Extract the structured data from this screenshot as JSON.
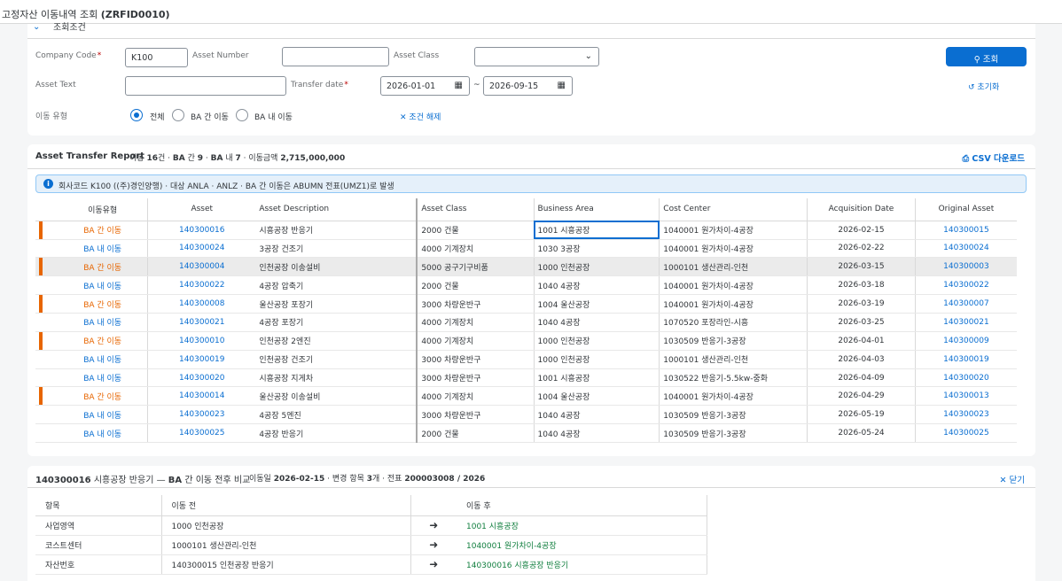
{
  "app": {
    "title": "고정자산 이동내역 조회",
    "code": "(ZRFID0010)"
  },
  "filters": {
    "section_title": "조회조건",
    "company_code_label": "Company Code",
    "company_code_value": "K100",
    "asset_number_label": "Asset Number",
    "asset_number_value": "",
    "asset_class_label": "Asset Class",
    "asset_class_value": "",
    "asset_text_label": "Asset Text",
    "asset_text_value": "",
    "transfer_date_label": "Transfer date",
    "date_from": "2026-01-01",
    "date_sep": "~",
    "date_to": "2026-09-15",
    "move_type_label": "이동 유형",
    "radio_all": "전체",
    "radio_inter": "BA 간 이동",
    "radio_intra": "BA 내 이동",
    "clear_label": "조건 해제",
    "search_label": "조회",
    "reset_label": "초기화"
  },
  "report": {
    "title": "Asset Transfer Report",
    "s_count_pre": "이동",
    "s_count": "16",
    "s_count_unit": "건 ·",
    "s_inter_pre": "BA",
    "s_inter_mid": "간",
    "s_inter": "9",
    "s_dot1": "·",
    "s_intra_pre": "BA",
    "s_intra_mid": "내",
    "s_intra": "7",
    "s_amount_pre": "· 이동금액",
    "s_amount": "2,715,000,000",
    "csv_label": "CSV 다운로드",
    "info": "회사코드 K100 ((주)경인양행) · 대상 ANLA · ANLZ · BA 간 이동은 ABUMN 전표(UMZ1)로 발생",
    "columns": [
      "이동유형",
      "Asset",
      "Asset Description",
      "Asset Class",
      "Business Area",
      "Cost Center",
      "Acquisition Date",
      "Original Asset"
    ],
    "rows": [
      {
        "type": "BA 간 이동",
        "kind": "inter",
        "asset": "140300016",
        "desc": "시흥공장 반응기",
        "cls": "2000 건물",
        "ba": "1001 시흥공장",
        "cc": "1040001 원가차이-4공장",
        "acq": "2026-02-15",
        "orig": "140300015"
      },
      {
        "type": "BA 내 이동",
        "kind": "intra",
        "asset": "140300024",
        "desc": "3공장 건조기",
        "cls": "4000 기계장치",
        "ba": "1030 3공장",
        "cc": "1040001 원가차이-4공장",
        "acq": "2026-02-22",
        "orig": "140300024"
      },
      {
        "type": "BA 간 이동",
        "kind": "inter",
        "asset": "140300004",
        "desc": "인천공장 이송설비",
        "cls": "5000 공구기구비품",
        "ba": "1000 인천공장",
        "cc": "1000101 생산관리-인천",
        "acq": "2026-03-15",
        "orig": "140300003"
      },
      {
        "type": "BA 내 이동",
        "kind": "intra",
        "asset": "140300022",
        "desc": "4공장 압축기",
        "cls": "2000 건물",
        "ba": "1040 4공장",
        "cc": "1040001 원가차이-4공장",
        "acq": "2026-03-18",
        "orig": "140300022"
      },
      {
        "type": "BA 간 이동",
        "kind": "inter",
        "asset": "140300008",
        "desc": "울산공장 포장기",
        "cls": "3000 차량운반구",
        "ba": "1004 울산공장",
        "cc": "1040001 원가차이-4공장",
        "acq": "2026-03-19",
        "orig": "140300007"
      },
      {
        "type": "BA 내 이동",
        "kind": "intra",
        "asset": "140300021",
        "desc": "4공장 포장기",
        "cls": "4000 기계장치",
        "ba": "1040 4공장",
        "cc": "1070520 포장라인-시흥",
        "acq": "2026-03-25",
        "orig": "140300021"
      },
      {
        "type": "BA 간 이동",
        "kind": "inter",
        "asset": "140300010",
        "desc": "인천공장 2엔진",
        "cls": "4000 기계장치",
        "ba": "1000 인천공장",
        "cc": "1030509 반응기-3공장",
        "acq": "2026-04-01",
        "orig": "140300009"
      },
      {
        "type": "BA 내 이동",
        "kind": "intra",
        "asset": "140300019",
        "desc": "인천공장 건조기",
        "cls": "3000 차량운반구",
        "ba": "1000 인천공장",
        "cc": "1000101 생산관리-인천",
        "acq": "2026-04-03",
        "orig": "140300019"
      },
      {
        "type": "BA 내 이동",
        "kind": "intra",
        "asset": "140300020",
        "desc": "시흥공장 지게차",
        "cls": "3000 차량운반구",
        "ba": "1001 시흥공장",
        "cc": "1030522 반응기-5.5kw-중화",
        "acq": "2026-04-09",
        "orig": "140300020"
      },
      {
        "type": "BA 간 이동",
        "kind": "inter",
        "asset": "140300014",
        "desc": "울산공장 이송설비",
        "cls": "4000 기계장치",
        "ba": "1004 울산공장",
        "cc": "1040001 원가차이-4공장",
        "acq": "2026-04-29",
        "orig": "140300013"
      },
      {
        "type": "BA 내 이동",
        "kind": "intra",
        "asset": "140300023",
        "desc": "4공장 5엔진",
        "cls": "3000 차량운반구",
        "ba": "1040 4공장",
        "cc": "1030509 반응기-3공장",
        "acq": "2026-05-19",
        "orig": "140300023"
      },
      {
        "type": "BA 내 이동",
        "kind": "intra",
        "asset": "140300025",
        "desc": "4공장 반응기",
        "cls": "2000 건물",
        "ba": "1040 4공장",
        "cc": "1030509 반응기-3공장",
        "acq": "2026-05-24",
        "orig": "140300025"
      }
    ]
  },
  "compare": {
    "t_asset": "140300016",
    "t_name": "시흥공장 반응기 —",
    "t_ba": "BA",
    "t_rest": "간 이동 전후 비교",
    "s_date_pre": "이동일",
    "s_date": "2026-02-15",
    "s_items_pre": "· 변경 항목",
    "s_items": "3",
    "s_items_unit": "개 · 전표",
    "s_doc": "200003008 / 2026",
    "close_label": "닫기",
    "columns": [
      "항목",
      "이동 전",
      "",
      "이동 후"
    ],
    "rows": [
      {
        "item": "사업영역",
        "before": "1000 인천공장",
        "after": "1001 시흥공장"
      },
      {
        "item": "코스트센터",
        "before": "1000101 생산관리-인천",
        "after": "1040001 원가차이-4공장"
      },
      {
        "item": "자산번호",
        "before": "140300015 인천공장 반응기",
        "after": "140300016 시흥공장 반응기"
      }
    ]
  }
}
